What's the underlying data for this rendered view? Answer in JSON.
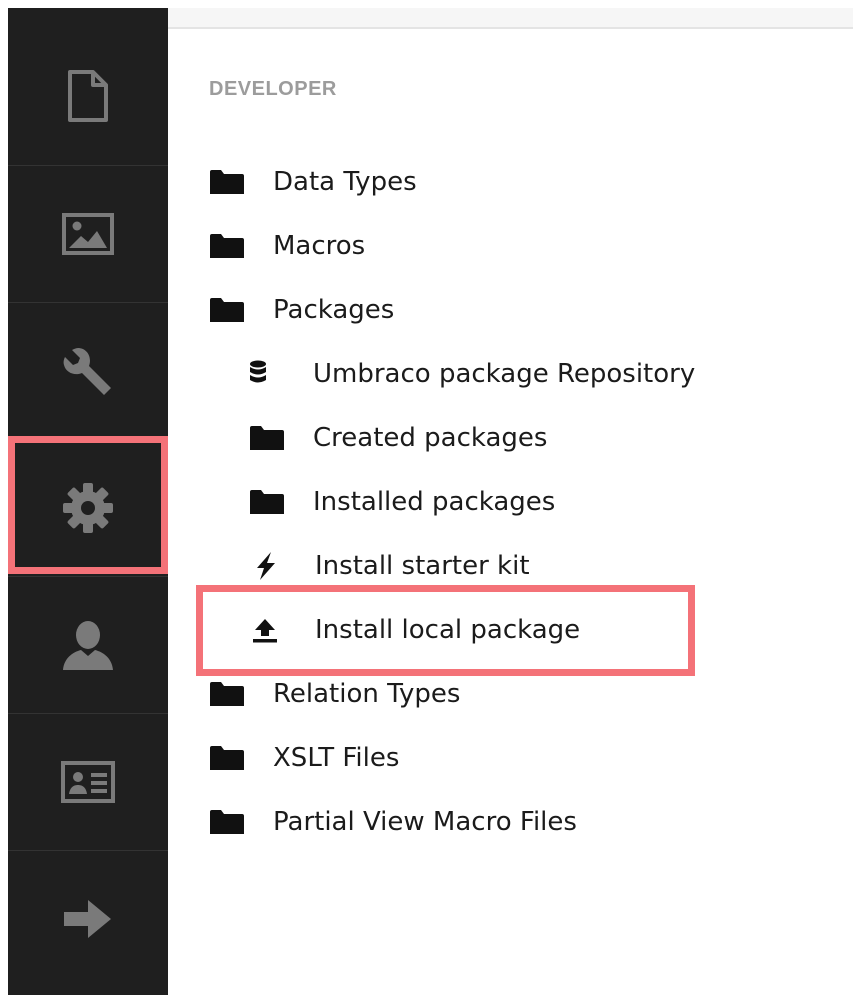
{
  "sidebar": {
    "items": [
      {
        "name": "content",
        "icon": "document-icon"
      },
      {
        "name": "media",
        "icon": "image-icon"
      },
      {
        "name": "settings",
        "icon": "wrench-icon"
      },
      {
        "name": "developer",
        "icon": "gear-icon"
      },
      {
        "name": "users",
        "icon": "user-icon"
      },
      {
        "name": "members",
        "icon": "id-card-icon"
      },
      {
        "name": "logout",
        "icon": "arrow-right-icon"
      }
    ],
    "active": "developer"
  },
  "tree": {
    "section_title": "DEVELOPER",
    "items": [
      {
        "label": "Data Types",
        "icon": "folder-icon"
      },
      {
        "label": "Macros",
        "icon": "folder-icon"
      },
      {
        "label": "Packages",
        "icon": "folder-icon"
      },
      {
        "label": "Umbraco package Repository",
        "icon": "database-icon"
      },
      {
        "label": "Created packages",
        "icon": "folder-icon"
      },
      {
        "label": "Installed packages",
        "icon": "folder-icon"
      },
      {
        "label": "Install starter kit",
        "icon": "lightning-icon"
      },
      {
        "label": "Install local package",
        "icon": "upload-icon"
      },
      {
        "label": "Relation Types",
        "icon": "folder-icon"
      },
      {
        "label": "XSLT Files",
        "icon": "folder-icon"
      },
      {
        "label": "Partial View Macro Files",
        "icon": "folder-icon"
      }
    ]
  },
  "colors": {
    "sidebar_bg": "#1f1f1f",
    "sidebar_icon": "#7a7a7a",
    "highlight": "#f47278",
    "section_title": "#9c9c9c",
    "text": "#1b1b1b"
  }
}
